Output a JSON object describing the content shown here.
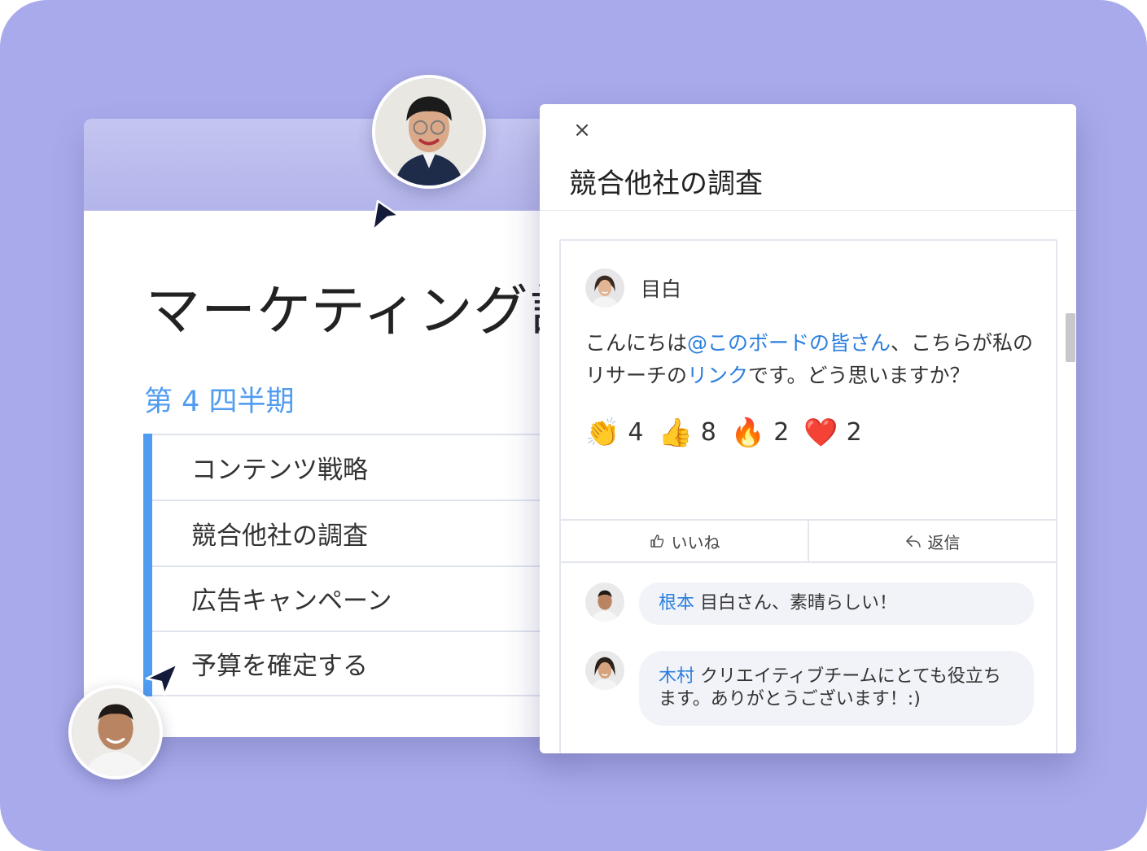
{
  "board": {
    "title": "マーケティング計",
    "subtitle": "第 4 四半期",
    "items": [
      {
        "label": "コンテンツ戦略"
      },
      {
        "label": "競合他社の調査"
      },
      {
        "label": "広告キャンペーン"
      },
      {
        "label": "予算を確定する"
      }
    ]
  },
  "panel": {
    "close_icon": "×",
    "title": "競合他社の調査",
    "post": {
      "author": "目白",
      "text_before": "こんにちは",
      "mention": "@このボードの皆さん",
      "text_middle": "、こちらが私のリサーチの",
      "link": "リンク",
      "text_after": "です。どう思いますか？",
      "reactions": [
        {
          "emoji": "👏",
          "count": "4"
        },
        {
          "emoji": "👍",
          "count": "8"
        },
        {
          "emoji": "🔥",
          "count": "2"
        },
        {
          "emoji": "❤️",
          "count": "2"
        }
      ],
      "like_label": "いいね",
      "reply_label": "返信"
    },
    "comments": [
      {
        "author": "根本",
        "text": " 目白さん、素晴らしい！"
      },
      {
        "author": "木村",
        "text": " クリエイティブチームにとても役立ちます。ありがとうございます！:)"
      }
    ]
  },
  "colors": {
    "background": "#a9aaeb",
    "accent": "#4f9cf0",
    "link": "#2b7fde"
  }
}
